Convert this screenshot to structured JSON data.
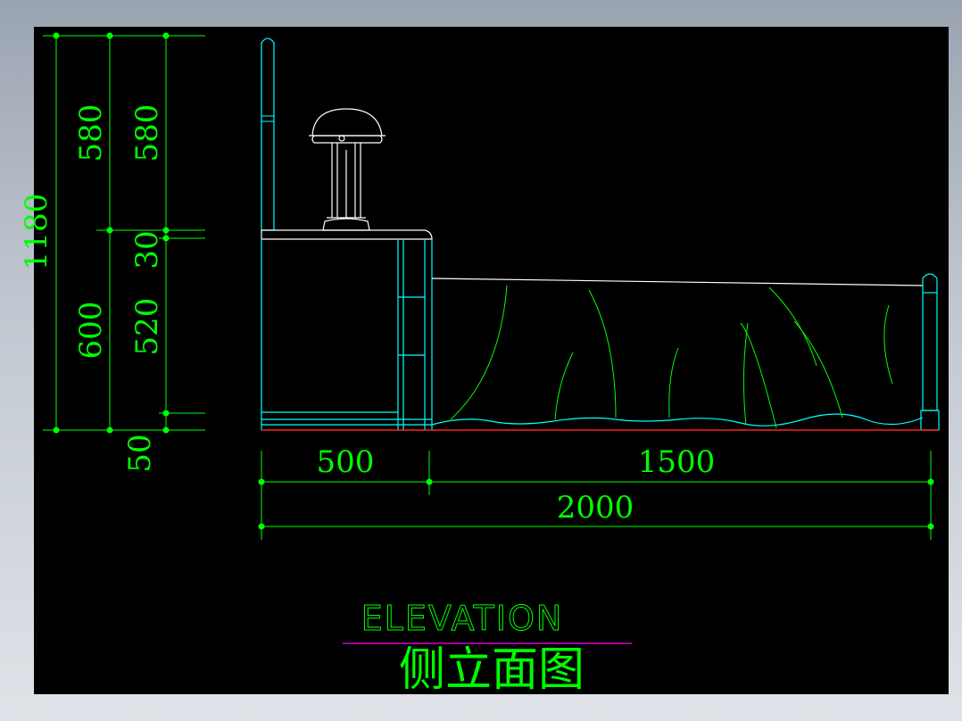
{
  "drawing": {
    "title_en": "ELEVATION",
    "title_zh": "侧立面图"
  },
  "dimensions": {
    "left_outer": {
      "total": "1180"
    },
    "left_mid": {
      "upper": "580",
      "lower": "600"
    },
    "left_inner": {
      "upper": "580",
      "slab": "30",
      "body": "520",
      "base": "50"
    },
    "bottom": {
      "nightstand": "500",
      "bed": "1500",
      "total": "2000"
    }
  },
  "colors": {
    "background": "#000000",
    "dimension": "#00ff00",
    "outline_cyan": "#00ffff",
    "outline_white": "#ffffff",
    "floor_red": "#ff0000",
    "title_underline": "#ff00ff"
  }
}
